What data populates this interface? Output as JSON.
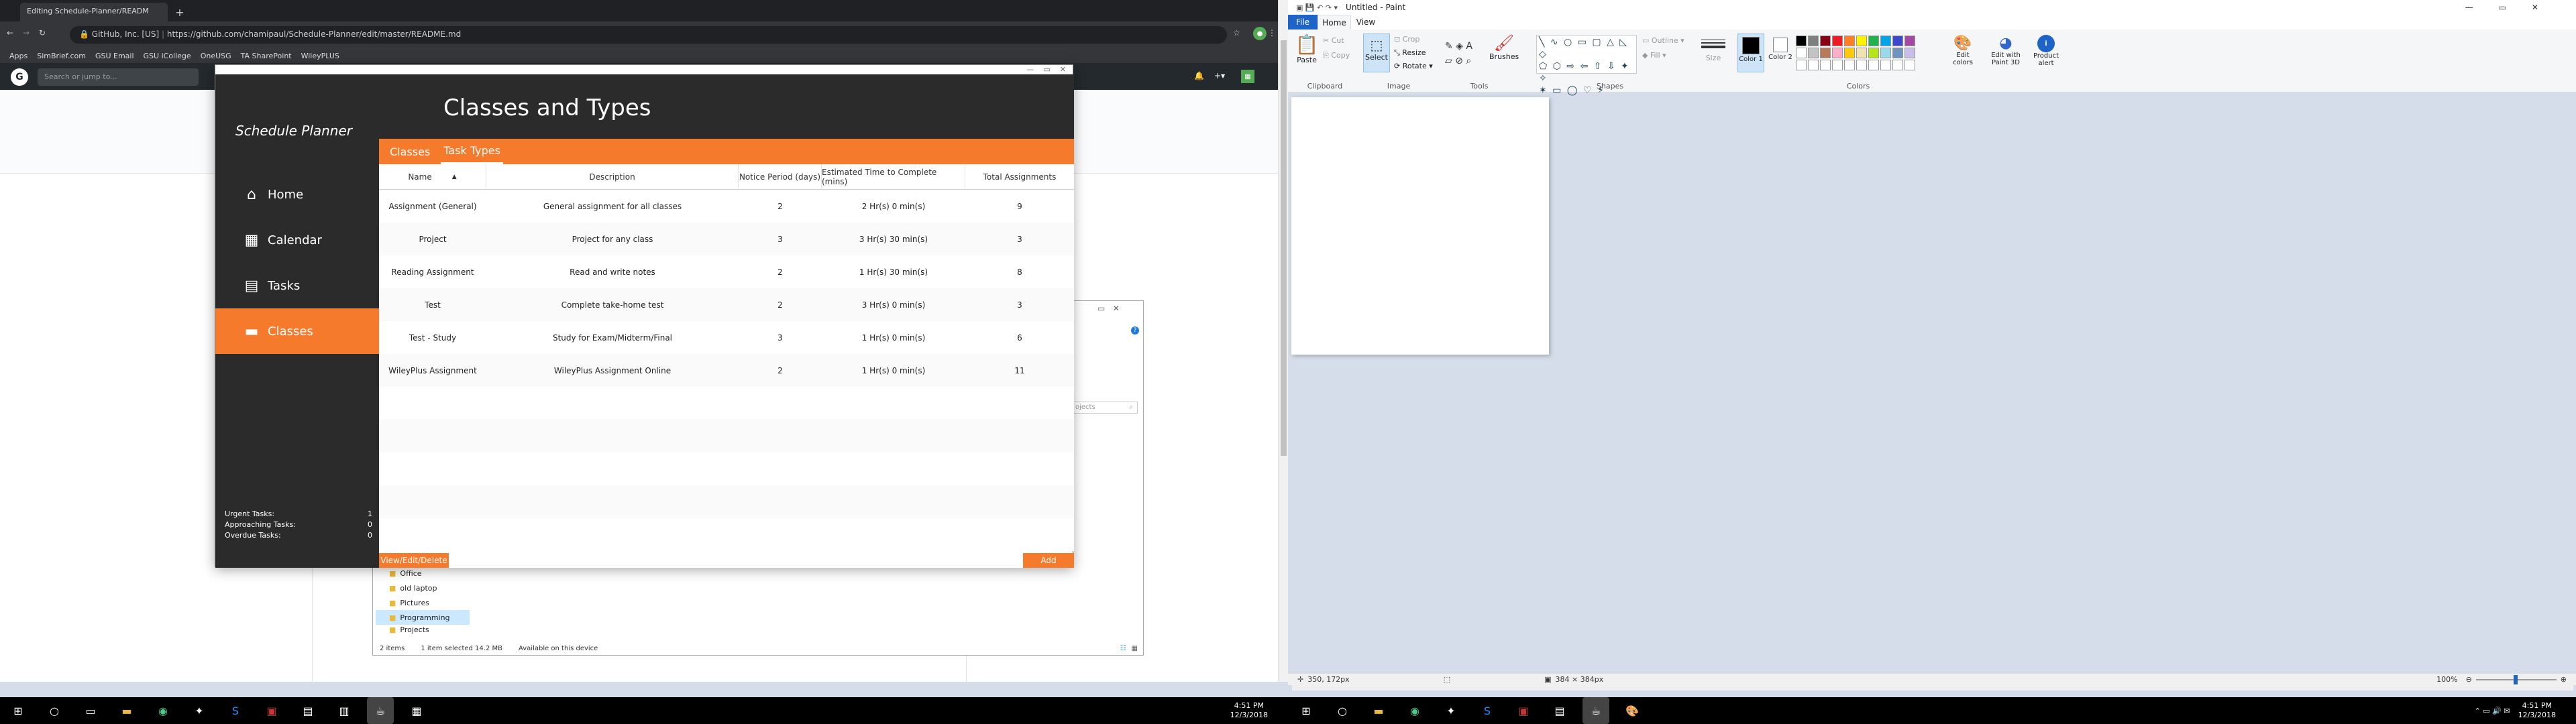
{
  "chrome": {
    "tab_title": "Editing Schedule-Planner/READM",
    "url_site": "GitHub, Inc. [US]",
    "url": "https://github.com/chamipaul/Schedule-Planner/edit/master/README.md",
    "bookmarks": [
      "Apps",
      "SimBrief.com",
      "GSU Email",
      "GSU iCollege",
      "OneUSG",
      "TA SharePoint",
      "WileyPLUS"
    ],
    "github_search_placeholder": "Search or jump to..."
  },
  "planner": {
    "app_name": "Schedule Planner",
    "page_title": "Classes and Types",
    "nav": [
      {
        "label": "Home",
        "icon": "home-icon"
      },
      {
        "label": "Calendar",
        "icon": "calendar-icon"
      },
      {
        "label": "Tasks",
        "icon": "tasks-icon"
      },
      {
        "label": "Classes",
        "icon": "folder-icon",
        "active": true
      }
    ],
    "tabs": [
      {
        "label": "Classes",
        "selected": false
      },
      {
        "label": "Task Types",
        "selected": true
      }
    ],
    "columns": [
      "Name",
      "Description",
      "Notice Period (days)",
      "Estimated Time to Complete (mins)",
      "Total Assignments"
    ],
    "rows": [
      [
        "Assignment (General)",
        "General assignment for all classes",
        "2",
        "2 Hr(s) 0 min(s)",
        "9"
      ],
      [
        "Project",
        "Project for any class",
        "3",
        "3 Hr(s) 30 min(s)",
        "3"
      ],
      [
        "Reading Assignment",
        "Read and write notes",
        "2",
        "1 Hr(s) 30 min(s)",
        "8"
      ],
      [
        "Test",
        "Complete take-home test",
        "2",
        "3 Hr(s) 0 min(s)",
        "3"
      ],
      [
        "Test - Study",
        "Study for Exam/Midterm/Final",
        "3",
        "1 Hr(s) 0 min(s)",
        "6"
      ],
      [
        "WileyPlus Assignment",
        "WileyPlus Assignment Online",
        "2",
        "1 Hr(s) 0 min(s)",
        "11"
      ]
    ],
    "stats": [
      {
        "label": "Urgent Tasks:",
        "value": "1"
      },
      {
        "label": "Approaching Tasks:",
        "value": "0"
      },
      {
        "label": "Overdue Tasks:",
        "value": "0"
      }
    ],
    "view_button": "View/Edit/Delete",
    "add_button": "Add"
  },
  "explorer": {
    "folders": [
      "Office",
      "old laptop",
      "Pictures",
      "Programming",
      "Projects"
    ],
    "selected_folder": "Programming",
    "status": [
      "2 items",
      "1 item selected  14.2 MB",
      "Available on this device"
    ],
    "search_placeholder": "ojects"
  },
  "paint": {
    "title": "Untitled - Paint",
    "menu": [
      "File",
      "Home",
      "View"
    ],
    "groups": [
      "Clipboard",
      "Image",
      "Tools",
      "Shapes",
      "Colors"
    ],
    "clipboard": {
      "paste": "Paste",
      "cut": "Cut",
      "copy": "Copy"
    },
    "image": {
      "select": "Select",
      "crop": "Crop",
      "resize": "Resize",
      "rotate": "Rotate"
    },
    "brushes": "Brushes",
    "outline": "Outline",
    "fill": "Fill",
    "size": "Size",
    "color1": "Color 1",
    "color2": "Color 2",
    "edit_colors": "Edit colors",
    "edit_paint3d": "Edit with Paint 3D",
    "product_alert": "Product alert",
    "status_coords": "350, 172px",
    "status_size": "384 × 384px",
    "zoom": "100%"
  },
  "taskbar": {
    "time": "4:51 PM",
    "date": "12/3/2018"
  },
  "colors": {
    "orange": "#f57a2b",
    "dark": "#2b2b2b",
    "palette": [
      "#000000",
      "#7f7f7f",
      "#880015",
      "#ed1c24",
      "#ff7f27",
      "#fff200",
      "#22b14c",
      "#00a2e8",
      "#3f48cc",
      "#a349a4",
      "#ffffff",
      "#c3c3c3",
      "#b97a57",
      "#ffaec9",
      "#ffc90e",
      "#efe4b0",
      "#b5e61d",
      "#99d9ea",
      "#7092be",
      "#c8bfe7"
    ]
  }
}
